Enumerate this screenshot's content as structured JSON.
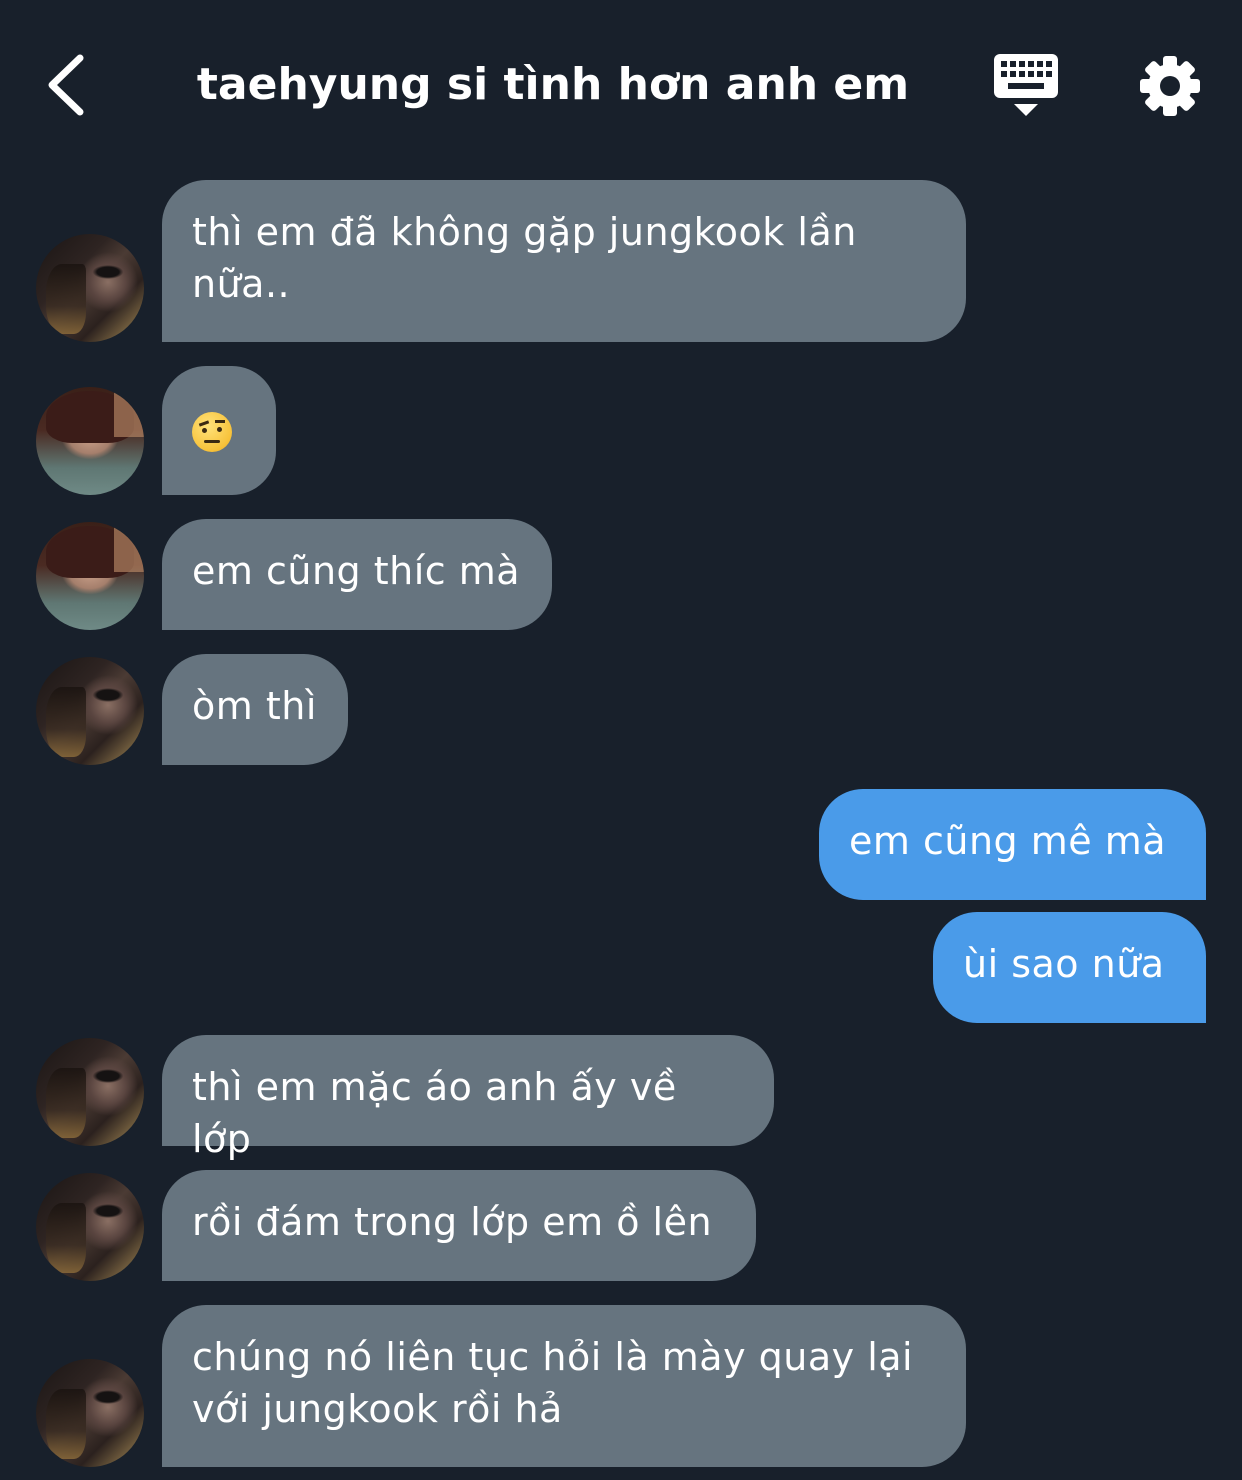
{
  "header": {
    "title": "taehyung si tình hơn anh em",
    "back_icon": "chevron-left-icon",
    "keyboard_icon": "keyboard-hide-icon",
    "settings_icon": "gear-icon"
  },
  "colors": {
    "background": "#18202b",
    "incoming_bubble": "#66747f",
    "outgoing_bubble": "#4a9be9",
    "text": "#ffffff"
  },
  "messages": [
    {
      "direction": "incoming",
      "avatar": "avatar-a",
      "text": "thì em đã không gặp jungkook lần nữa.."
    },
    {
      "direction": "incoming",
      "avatar": "avatar-b",
      "text": "",
      "emoji": "face-with-raised-eyebrow"
    },
    {
      "direction": "incoming",
      "avatar": "avatar-b",
      "text": "em cũng thíc mà"
    },
    {
      "direction": "incoming",
      "avatar": "avatar-a",
      "text": "òm thì"
    },
    {
      "direction": "outgoing",
      "text": "em cũng mê mà"
    },
    {
      "direction": "outgoing",
      "text": "ùi sao nữa"
    },
    {
      "direction": "incoming",
      "avatar": "avatar-a",
      "text": "thì em mặc áo anh ấy về lớp"
    },
    {
      "direction": "incoming",
      "avatar": "avatar-a",
      "text": "rồi đám trong lớp em ồ lên"
    },
    {
      "direction": "incoming",
      "avatar": "avatar-a",
      "text": "chúng nó liên tục hỏi là mày quay lại với jungkook rồi hả"
    }
  ]
}
